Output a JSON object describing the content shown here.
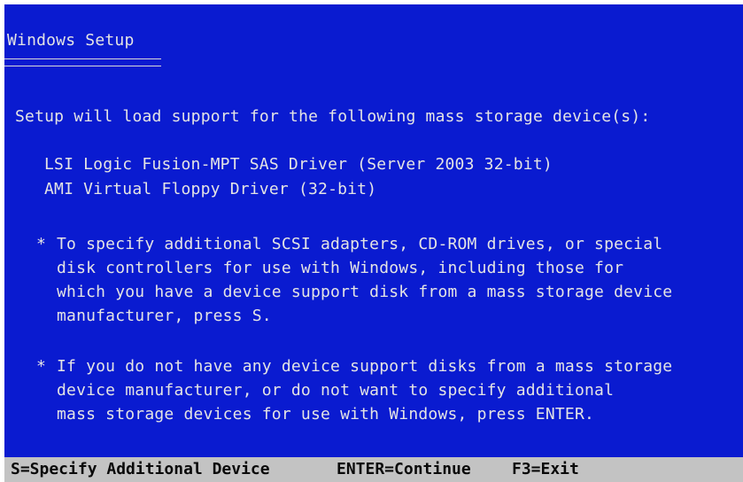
{
  "window": {
    "title": "Windows Setup"
  },
  "intro": "Setup will load support for the following mass storage device(s):",
  "devices": [
    "LSI Logic Fusion-MPT SAS Driver (Server 2003 32-bit)",
    "AMI Virtual Floppy Driver (32-bit)"
  ],
  "bullet_glyph": "*",
  "instructions": [
    {
      "lines": [
        "To specify additional SCSI adapters, CD-ROM drives, or special",
        "disk controllers for use with Windows, including those for",
        "which you have a device support disk from a mass storage device",
        "manufacturer, press S."
      ]
    },
    {
      "lines": [
        "If you do not have any device support disks from a mass storage",
        "device manufacturer, or do not want to specify additional",
        "mass storage devices for use with Windows, press ENTER."
      ]
    }
  ],
  "status_bar": {
    "items": [
      "S=Specify Additional Device",
      "ENTER=Continue",
      "F3=Exit"
    ]
  },
  "colors": {
    "background": "#0a1bd0",
    "text": "#e4e4e4",
    "status_bar_bg": "#c3c3c3",
    "status_bar_text": "#0a0a0a"
  }
}
